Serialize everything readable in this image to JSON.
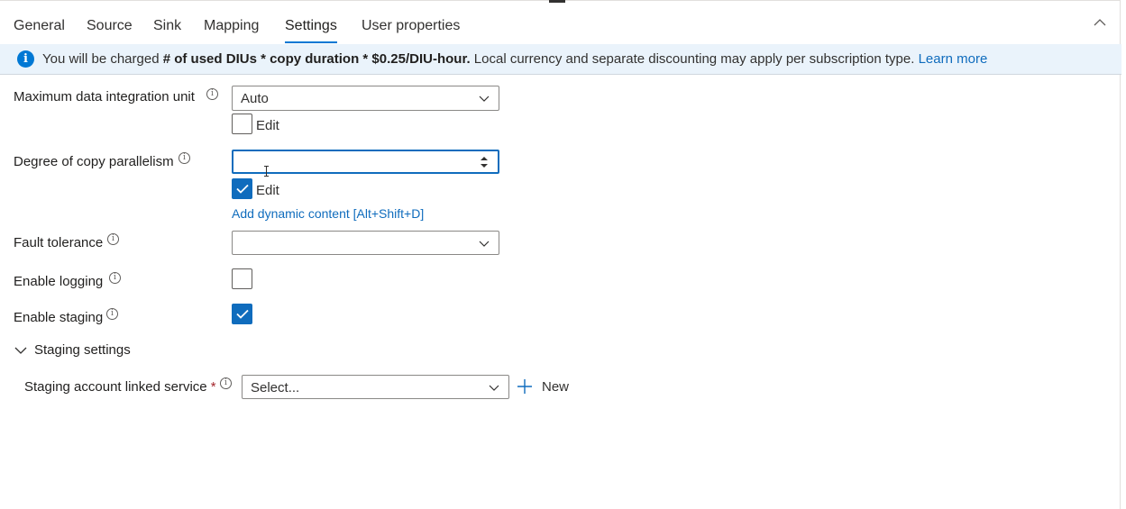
{
  "tabs": [
    {
      "label": "General"
    },
    {
      "label": "Source"
    },
    {
      "label": "Sink"
    },
    {
      "label": "Mapping"
    },
    {
      "label": "Settings",
      "active": true
    },
    {
      "label": "User properties"
    }
  ],
  "infobar": {
    "prefix": "You will be charged ",
    "bold": "# of used DIUs * copy duration * $0.25/DIU-hour.",
    "suffix": " Local currency and separate discounting may apply per subscription type. ",
    "link": "Learn more"
  },
  "fields": {
    "diu": {
      "label": "Maximum data integration unit",
      "value": "Auto",
      "edit_label": "Edit",
      "edit_checked": false
    },
    "parallelism": {
      "label": "Degree of copy parallelism",
      "value": "",
      "edit_label": "Edit",
      "edit_checked": true,
      "dynamic_link": "Add dynamic content [Alt+Shift+D]"
    },
    "fault_tolerance": {
      "label": "Fault tolerance",
      "value": ""
    },
    "logging": {
      "label": "Enable logging",
      "checked": false
    },
    "staging": {
      "label": "Enable staging",
      "checked": true
    }
  },
  "staging_settings": {
    "section_label": "Staging settings",
    "linked_service_label": "Staging account linked service",
    "required_mark": "*",
    "placeholder": "Select...",
    "new_label": "New"
  },
  "colors": {
    "accent": "#0f6cbd",
    "info_bg": "#eaf3fb",
    "tab_underline": "#0078d4"
  },
  "icons": {
    "info": "info-icon",
    "collapse": "chevron-up-icon",
    "dropdown": "chevron-down-icon",
    "check": "checkmark-icon",
    "add": "plus-icon"
  }
}
